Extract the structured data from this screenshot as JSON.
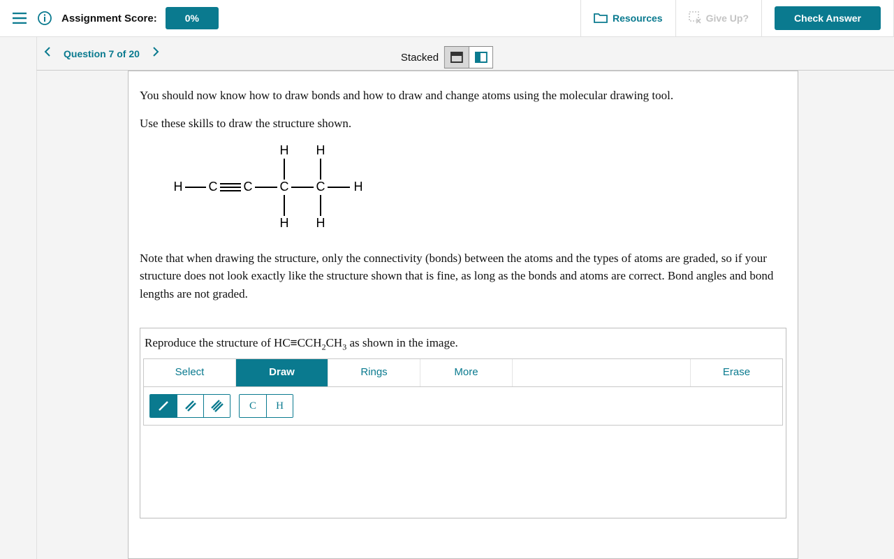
{
  "topbar": {
    "score_label": "Assignment Score:",
    "score_value": "0%",
    "resources": "Resources",
    "give_up": "Give Up?",
    "check_answer": "Check Answer"
  },
  "subbar": {
    "question_label": "Question 7 of 20",
    "stacked_label": "Stacked"
  },
  "question": {
    "p1": "You should now know how to draw bonds and how to draw and change atoms using the molecular drawing tool.",
    "p2": "Use these skills to draw the structure shown.",
    "p3": "Note that when drawing the structure, only the connectivity (bonds) between the atoms and the types of atoms are graded, so if your structure does not look exactly like the structure shown that is fine, as long as the bonds and atoms are correct. Bond angles and bond lengths are not graded."
  },
  "molecule": {
    "atoms": [
      "H",
      "C",
      "C",
      "C",
      "C",
      "H",
      "H",
      "H",
      "H",
      "H"
    ],
    "smiles_label": "HC≡CCH2CH3"
  },
  "drawtool": {
    "prompt_pre": "Reproduce the structure of HC",
    "prompt_mid1": "CCH",
    "prompt_mid2": "CH",
    "prompt_post": " as shown in the image.",
    "tabs": {
      "select": "Select",
      "draw": "Draw",
      "rings": "Rings",
      "more": "More",
      "erase": "Erase"
    },
    "bond_single": "/",
    "bond_double": "//",
    "bond_triple": "///",
    "atom_c": "C",
    "atom_h": "H"
  }
}
